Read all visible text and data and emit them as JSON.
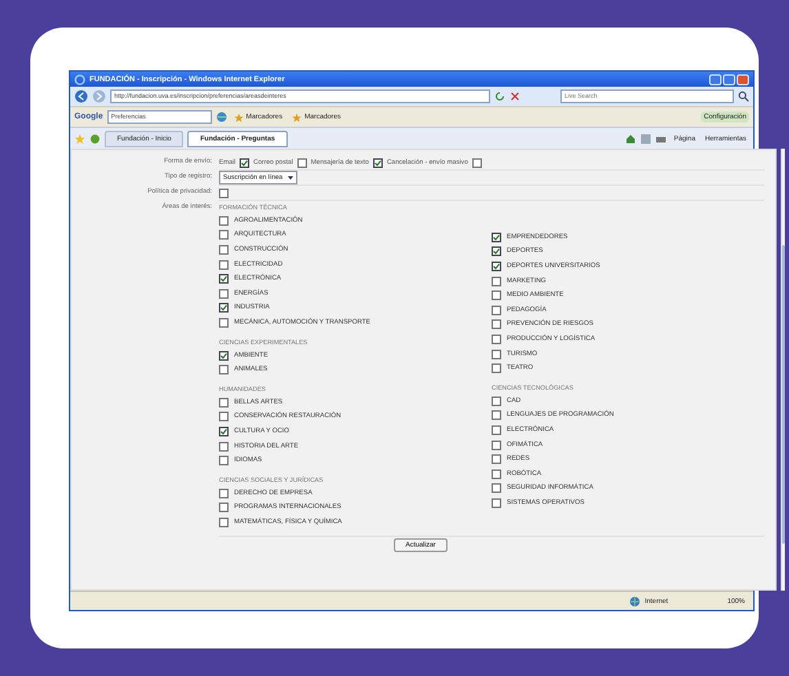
{
  "window": {
    "title": "FUNDACIÓN - Inscripción - Windows Internet Explorer"
  },
  "address_bar": {
    "value": "http://fundacion.uva.es/inscripcion/preferencias/areasdeinteres",
    "search_placeholder": "Live Search"
  },
  "google_toolbar": {
    "label": "Google",
    "search_value": "Preferencias",
    "items": [
      "Marcadores",
      "Marcadores"
    ],
    "settings": "Configuración"
  },
  "tabs": [
    {
      "label": "Fundación - Inicio",
      "selected": false
    },
    {
      "label": "Fundación - Preguntas",
      "selected": true
    }
  ],
  "command_bar": [
    "Página",
    "Herramientas"
  ],
  "form": {
    "rows": [
      {
        "label": "Forma de envío:",
        "kind": "options",
        "options": [
          {
            "label": "Email",
            "checked": true
          },
          {
            "label": "Correo postal",
            "checked": false
          },
          {
            "label": "Mensajería de texto",
            "checked": true
          },
          {
            "label": "Cancelación - envío masivo",
            "checked": false
          }
        ]
      },
      {
        "label": "Tipo de registro:",
        "kind": "select",
        "value": "Suscripción en línea"
      },
      {
        "label": "Política de privacidad:",
        "kind": "check",
        "checked": false
      },
      {
        "label": "Áreas de interés:",
        "kind": "areas"
      }
    ],
    "columns": [
      [
        {
          "title": "FORMACIÓN TÉCNICA",
          "items": [
            {
              "label": "AGROALIMENTACIÓN",
              "checked": false
            },
            {
              "label": "ARQUITECTURA",
              "checked": false
            },
            {
              "label": "CONSTRUCCIÓN",
              "checked": false
            },
            {
              "label": "ELECTRICIDAD",
              "checked": false
            },
            {
              "label": "ELECTRÓNICA",
              "checked": true
            },
            {
              "label": "ENERGÍAS",
              "checked": false
            },
            {
              "label": "INDUSTRIA",
              "checked": true
            },
            {
              "label": "MECÁNICA, AUTOMOCIÓN Y TRANSPORTE",
              "checked": false
            }
          ]
        },
        {
          "title": "CIENCIAS EXPERIMENTALES",
          "items": [
            {
              "label": "AMBIENTE",
              "checked": true
            },
            {
              "label": "ANIMALES",
              "checked": false
            }
          ]
        },
        {
          "title": "HUMANIDADES",
          "items": [
            {
              "label": "BELLAS ARTES",
              "checked": false
            },
            {
              "label": "CONSERVACIÓN RESTAURACIÓN",
              "checked": false
            },
            {
              "label": "CULTURA Y OCIO",
              "checked": true
            },
            {
              "label": "HISTORIA DEL ARTE",
              "checked": false
            },
            {
              "label": "IDIOMAS",
              "checked": false
            }
          ]
        },
        {
          "title": "CIENCIAS SOCIALES Y JURÍDICAS",
          "items": [
            {
              "label": "DERECHO DE EMPRESA",
              "checked": false
            },
            {
              "label": "PROGRAMAS INTERNACIONALES",
              "checked": false
            },
            {
              "label": "MATEMÁTICAS, FÍSICA Y QUÍMICA",
              "checked": false
            }
          ]
        }
      ],
      [
        {
          "items": [
            {
              "label": "EMPRENDEDORES",
              "checked": true
            },
            {
              "label": "DEPORTES",
              "checked": true
            },
            {
              "label": "DEPORTES UNIVERSITARIOS",
              "checked": true
            },
            {
              "label": "MARKETING",
              "checked": false
            },
            {
              "label": "MEDIO AMBIENTE",
              "checked": false
            },
            {
              "label": "PEDAGOGÍA",
              "checked": false
            },
            {
              "label": "PREVENCIÓN DE RIESGOS",
              "checked": false
            },
            {
              "label": "PRODUCCIÓN Y LOGÍSTICA",
              "checked": false
            },
            {
              "label": "TURISMO",
              "checked": false
            },
            {
              "label": "TEATRO",
              "checked": false
            }
          ]
        },
        {
          "title": "CIENCIAS TECNOLÓGICAS",
          "items": [
            {
              "label": "CAD",
              "checked": false
            },
            {
              "label": "LENGUAJES DE PROGRAMACIÓN",
              "checked": false
            },
            {
              "label": "ELECTRÓNICA",
              "checked": false
            },
            {
              "label": "OFIMÁTICA",
              "checked": false
            },
            {
              "label": "REDES",
              "checked": false
            },
            {
              "label": "ROBÓTICA",
              "checked": false
            },
            {
              "label": "SEGURIDAD INFORMÁTICA",
              "checked": false
            },
            {
              "label": "SISTEMAS OPERATIVOS",
              "checked": false
            }
          ]
        }
      ]
    ],
    "submit": "Actualizar"
  },
  "status_bar": {
    "zone": "Internet",
    "zoom": "100%"
  }
}
